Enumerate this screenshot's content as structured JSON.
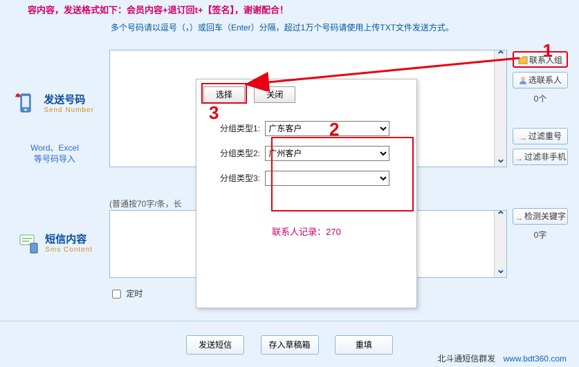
{
  "notice": "容内容，发送格式如下：会员内容+退订回t+【签名】，谢谢配合！",
  "hint": "多个号码请以逗号（，）或回车（Enter）分隔，超过1万个号码请使用上传TXT文件发送方式。",
  "side": {
    "number": {
      "main": "发送号码",
      "sub": "Send Number"
    },
    "sms": {
      "main": "短信内容",
      "sub": "Sms Content"
    },
    "import_line1": "Word、Excel",
    "import_line2": "等号码导入"
  },
  "plain70": "(普通按70字/条，长",
  "timed_label": "定时",
  "right": {
    "contact_group": "联系人组",
    "select_contact": "选联系人",
    "count_num": "0个",
    "filter_dup": "过滤重号",
    "filter_nonmobile": "过滤非手机",
    "check_keyword": "检测关键字",
    "char_count": "0字"
  },
  "dialog": {
    "select": "选择",
    "close": "关闭",
    "group_label1": "分组类型1:",
    "group_label2": "分组类型2:",
    "group_label3": "分组类型3:",
    "group_val1": "广东客户",
    "group_val2": "广州客户",
    "group_val3": "",
    "record": "联系人记录：270"
  },
  "buttons": {
    "send": "发送短信",
    "draft": "存入草稿箱",
    "reset": "重填"
  },
  "footer": {
    "brand": "北斗通短信群发",
    "url": "www.bdt360.com"
  },
  "anno": {
    "n1": "1",
    "n2": "2",
    "n3": "3"
  }
}
